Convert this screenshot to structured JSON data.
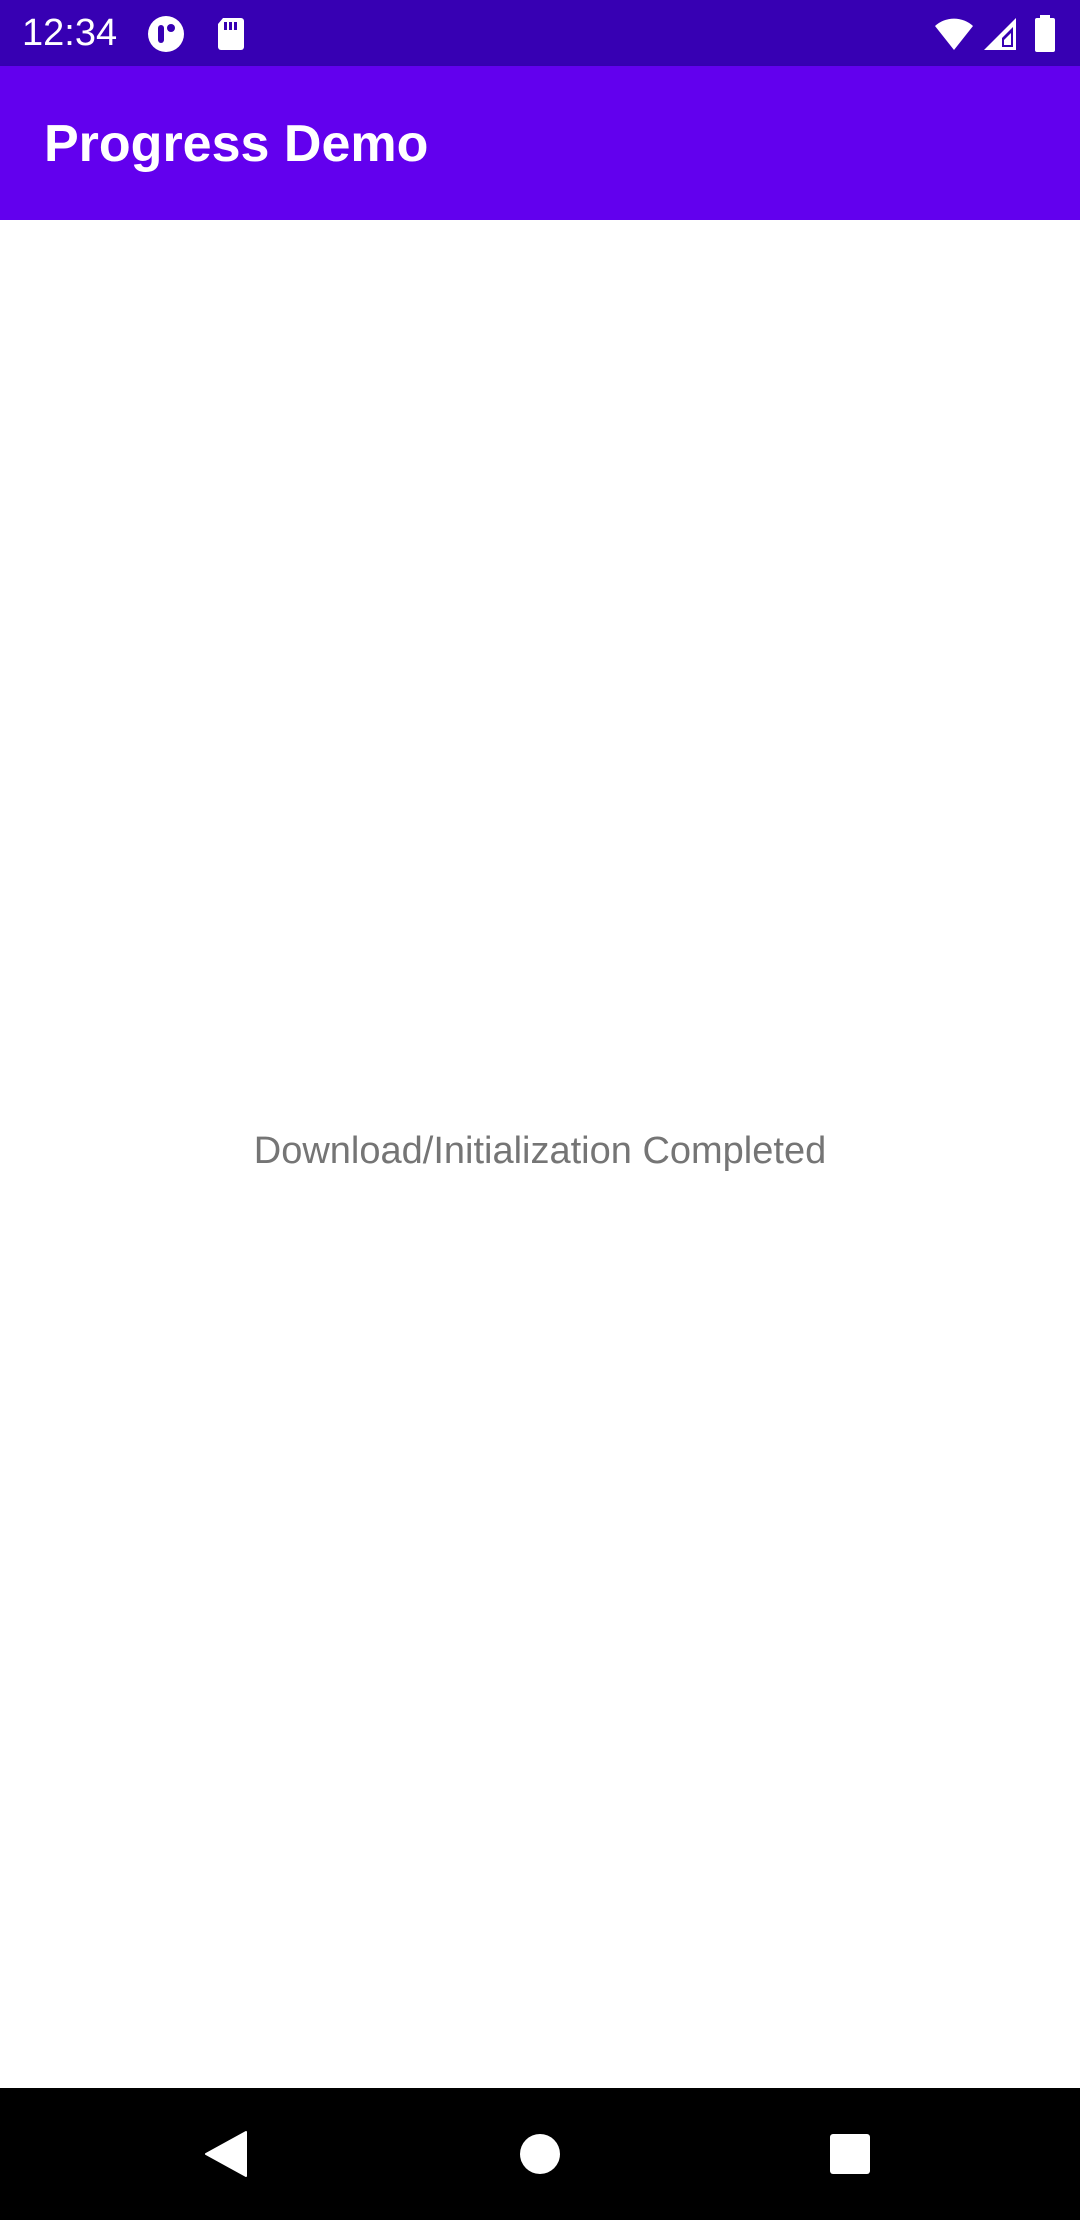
{
  "status_bar": {
    "time": "12:34",
    "icons": [
      "app-notification-icon",
      "sd-card-icon",
      "wifi-icon",
      "cell-signal-icon",
      "battery-icon"
    ],
    "background": "#3700b3"
  },
  "app_bar": {
    "title": "Progress Demo",
    "background": "#6200ee"
  },
  "content": {
    "message": "Download/Initialization Completed",
    "message_color": "#757575"
  },
  "nav_bar": {
    "buttons": [
      "back-icon",
      "home-icon",
      "recents-icon"
    ],
    "background": "#000000"
  }
}
